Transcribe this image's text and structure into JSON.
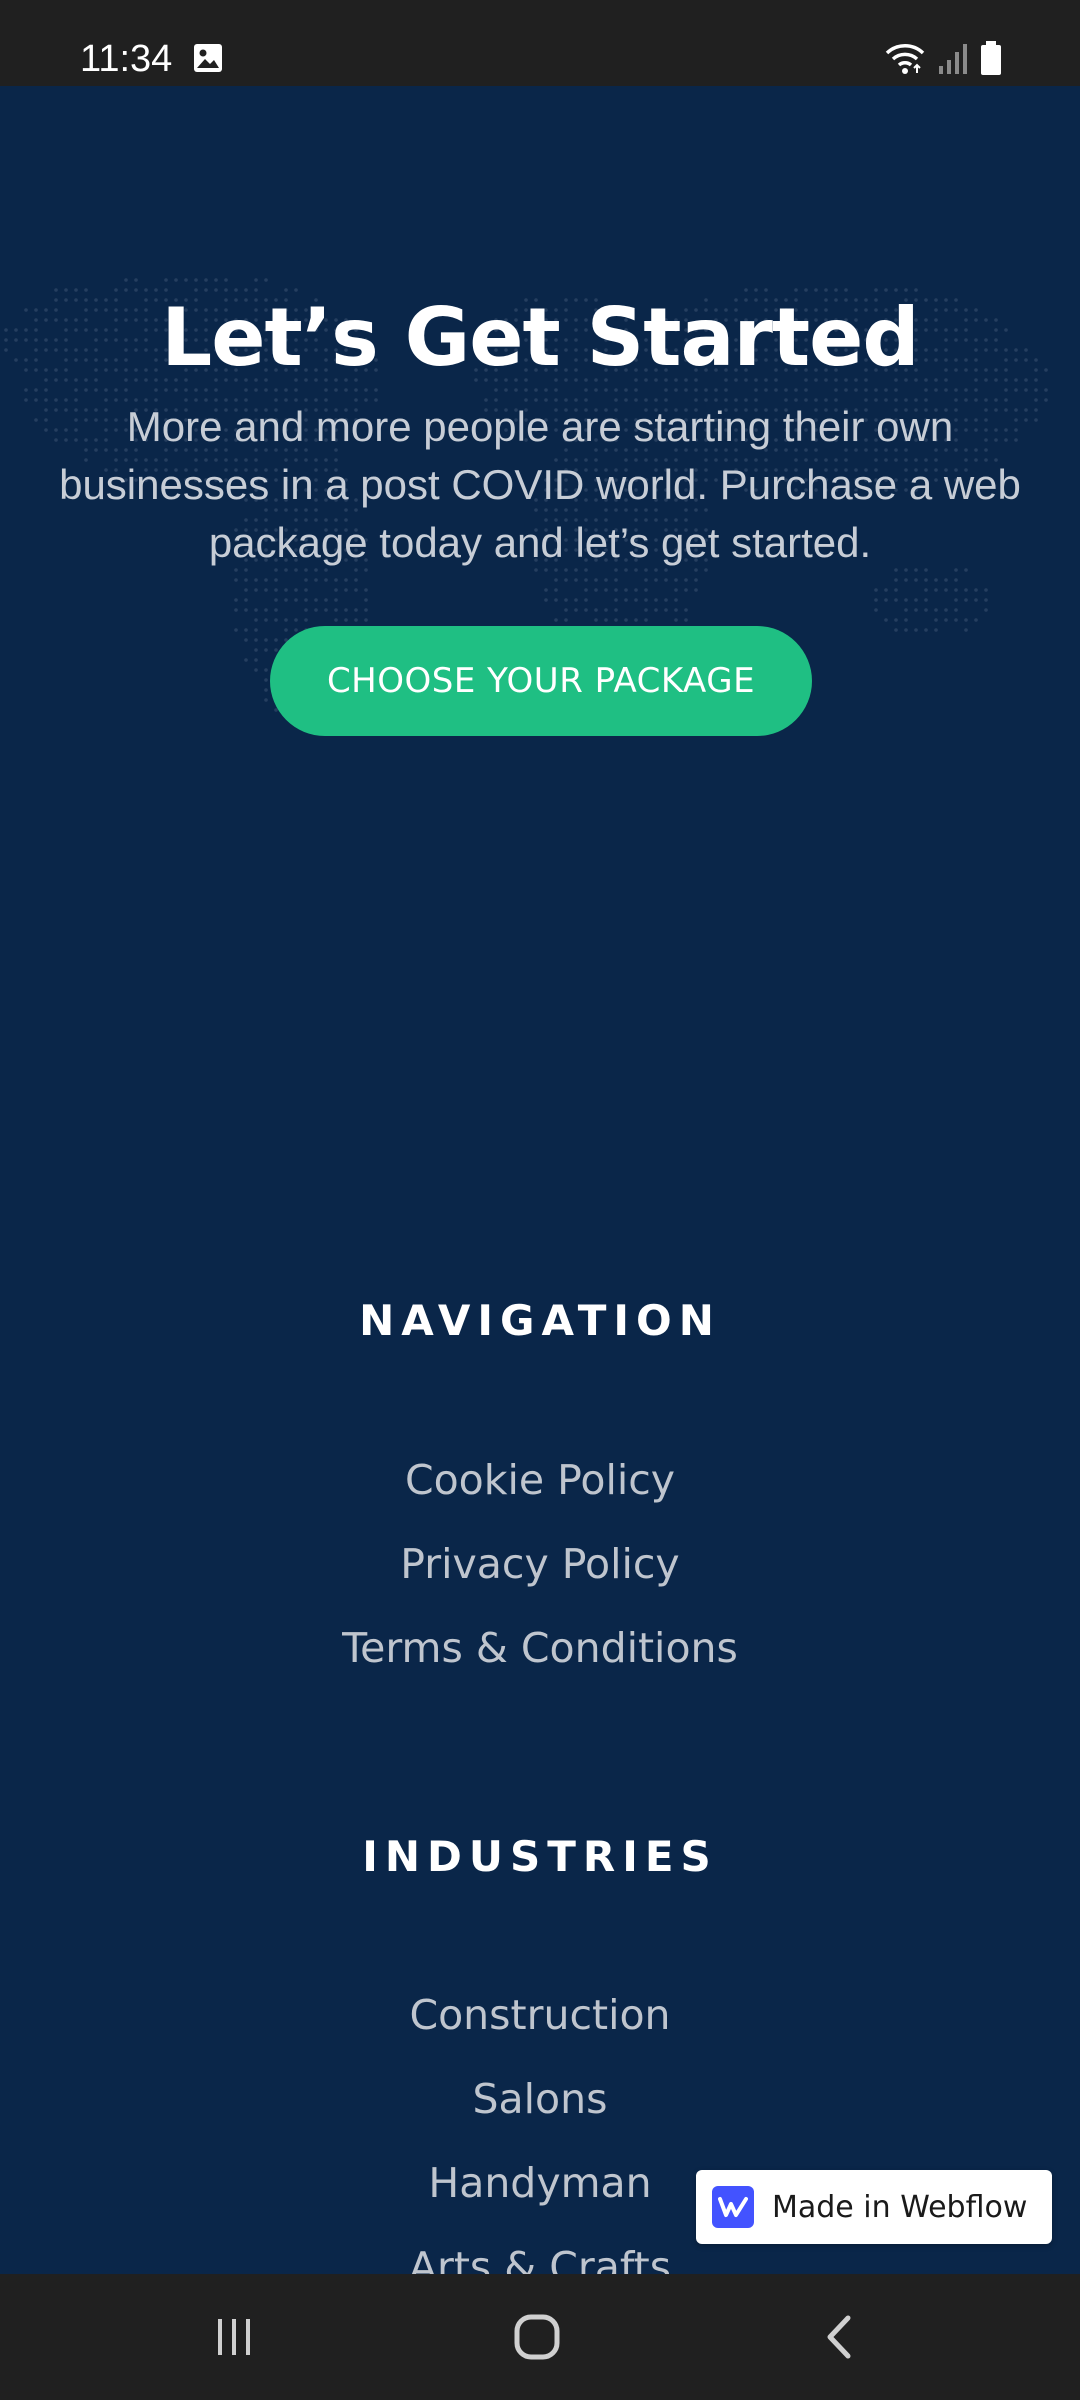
{
  "status_bar": {
    "time": "11:34",
    "icons": [
      "gallery-icon",
      "wifi-icon",
      "signal-icon",
      "battery-icon"
    ]
  },
  "hero": {
    "title": "Let’s Get Started",
    "body_lines": [
      "More and more people are starting their own",
      "businesses in a post COVID world. Purchase a web",
      "package today and let’s get started."
    ],
    "cta_label": "CHOOSE YOUR PACKAGE",
    "cta_color": "#1fbf83"
  },
  "navigation": {
    "heading": "NAVIGATION",
    "links": [
      "Cookie Policy",
      "Privacy Policy",
      "Terms & Conditions"
    ]
  },
  "industries": {
    "heading": "INDUSTRIES",
    "links": [
      "Construction",
      "Salons",
      "Handyman",
      "Arts & Crafts"
    ]
  },
  "badge": {
    "label": "Made in Webflow",
    "logo_letter": "W",
    "logo_color": "#4353ff"
  },
  "nav_bar": {
    "buttons": [
      "recents-icon",
      "home-icon",
      "back-icon"
    ]
  },
  "colors": {
    "background": "#0a2649",
    "status_bar": "#202020"
  }
}
